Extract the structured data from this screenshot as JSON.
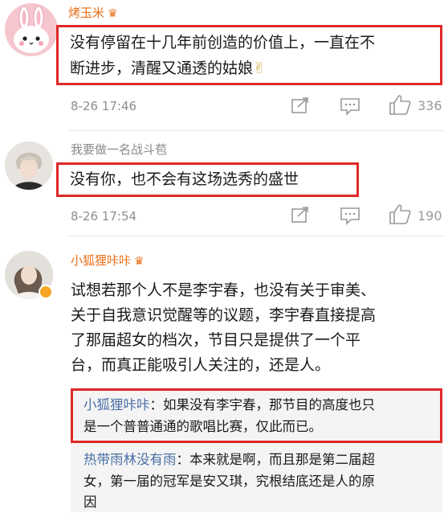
{
  "comments": [
    {
      "username": "烤玉米",
      "username_badge": "crown-badge-icon",
      "text_lines": [
        "没有停留在十几年前创造的价值上，一直在不",
        "断进步，清醒又通透的姑娘"
      ],
      "emoji": "✌",
      "timestamp": "8-26 17:46",
      "like_count": "336"
    },
    {
      "username": "我要做一名战斗苞",
      "text_lines": [
        "没有你，也不会有这场选秀的盛世"
      ],
      "timestamp": "8-26 17:54",
      "like_count": "190"
    },
    {
      "username": "小狐狸咔咔",
      "username_badge": "crown-badge-icon",
      "text_lines": [
        "试想若那个人不是李宇春，也没有关于审美、",
        "关于自我意识觉醒等的议题，李宇春直接提高",
        "了那届超女的档次，节目只是提供了一个平",
        "台，而真正能吸引人关注的，还是人。"
      ],
      "replies": [
        {
          "author": "小狐狸咔咔",
          "line1": "：如果没有李宇春，那节目的高度也只",
          "line2": "是一个普普通通的歌唱比赛，仅此而已。"
        },
        {
          "author": "热带雨林没有雨",
          "line1": "：本来就是啊，而且那是第二届超",
          "line2": "女，第一届的冠军是安又琪，究根结底还是人的原",
          "line3": "因"
        }
      ]
    }
  ],
  "colors": {
    "highlight_border": "#e02828",
    "username_orange": "#e8701a",
    "reply_author_blue": "#4a6fa5",
    "reply_bg": "#f4f4f4"
  },
  "icons": [
    "share-icon",
    "comment-icon",
    "like-icon",
    "verified-badge-icon"
  ]
}
